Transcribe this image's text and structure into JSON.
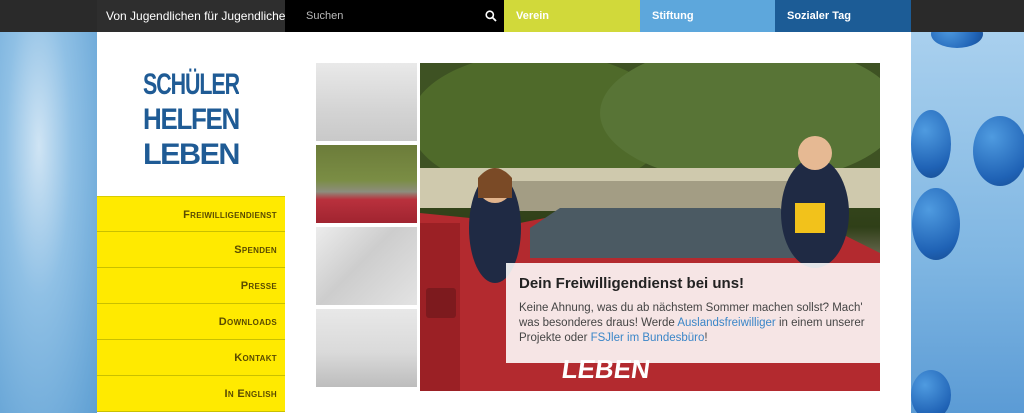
{
  "topbar": {
    "tagline": "Von Jugendlichen für Jugendliche",
    "search_placeholder": "Suchen",
    "search_icon": "search-icon",
    "tabs": [
      {
        "label": "Verein",
        "color": "#d1d93a"
      },
      {
        "label": "Stiftung",
        "color": "#5da7dc"
      },
      {
        "label": "Sozialer Tag",
        "color": "#1c5c96"
      }
    ]
  },
  "logo": {
    "line1": "SCHÜLER",
    "line2": "HELFEN",
    "line3": "LEBEN",
    "color": "#1f5b95"
  },
  "nav": {
    "items": [
      {
        "label": "Freiwilligendienst"
      },
      {
        "label": "Spenden"
      },
      {
        "label": "Presse"
      },
      {
        "label": "Downloads"
      },
      {
        "label": "Kontakt"
      },
      {
        "label": "In English"
      }
    ],
    "color": "#ffea00"
  },
  "hero": {
    "title": "Dein Freiwilligendienst bei uns!",
    "text_before": "Keine Ahnung, was du ab nächstem Sommer machen sollst? Mach' was besonderes draus! Werde ",
    "link1": "Auslandsfreiwilliger",
    "text_middle": " in einem unserer Projekte oder ",
    "link2": "FSJler im Bundesbüro",
    "text_after": "!",
    "car_label": "SCHÜLER HELFEN LEBEN"
  }
}
